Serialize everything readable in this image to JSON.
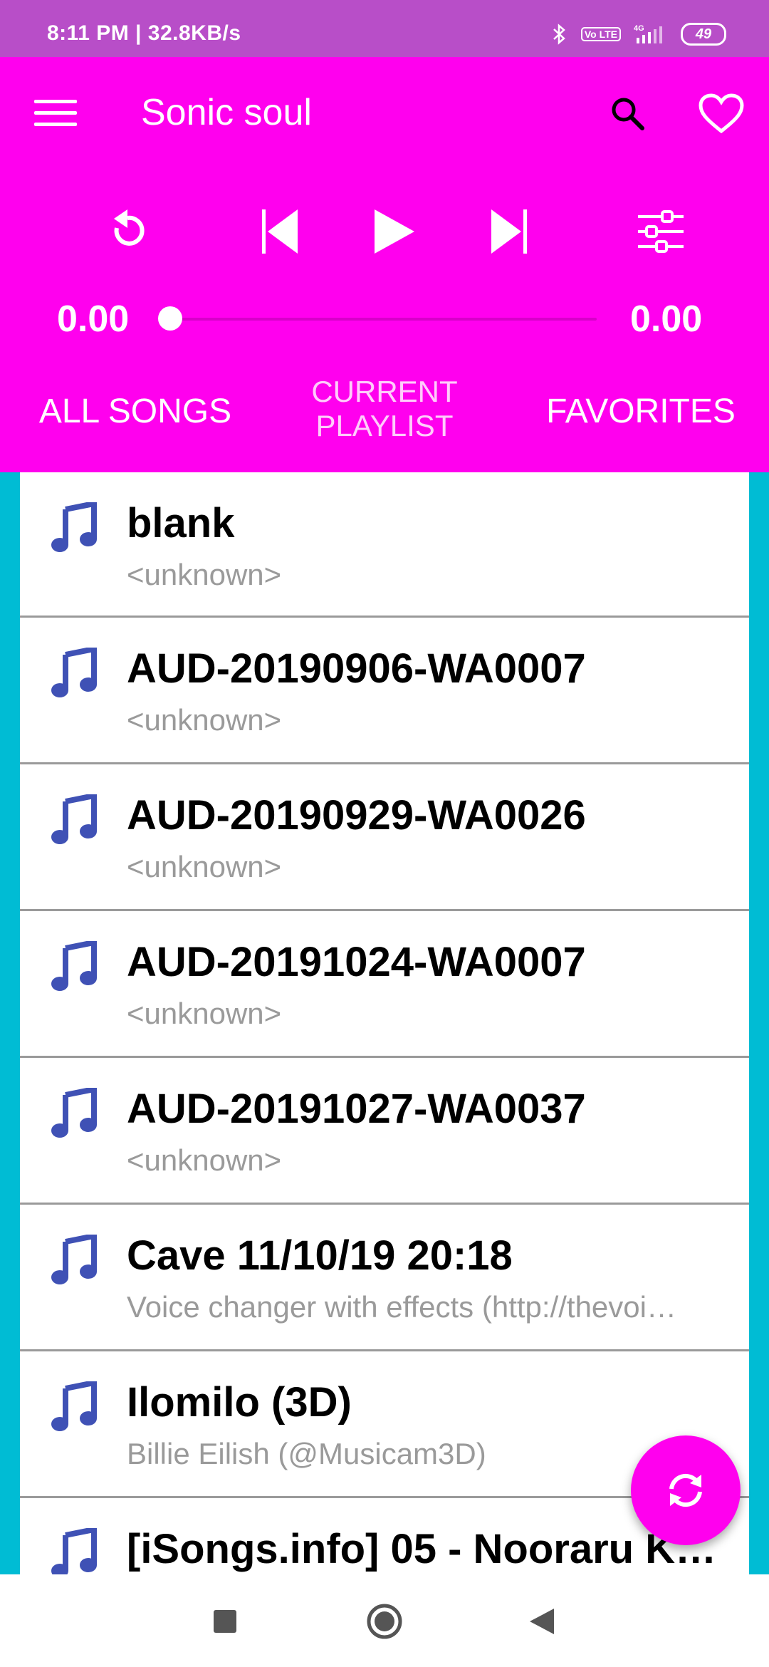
{
  "status_bar": {
    "time": "8:11 PM | 32.8KB/s",
    "battery": "49",
    "volte": "Vo LTE",
    "network": "4G"
  },
  "app": {
    "title": "Sonic soul",
    "accent_color": "#ff00ee",
    "list_background": "#00bcd4",
    "note_icon_color": "#3f51b5"
  },
  "player": {
    "elapsed": "0.00",
    "duration": "0.00",
    "progress": 0
  },
  "tabs": [
    {
      "label": "ALL SONGS"
    },
    {
      "label": "CURRENT PLAYLIST"
    },
    {
      "label": "FAVORITES"
    }
  ],
  "songs": [
    {
      "title": "blank",
      "artist": "<unknown>"
    },
    {
      "title": "AUD-20190906-WA0007",
      "artist": "<unknown>"
    },
    {
      "title": "AUD-20190929-WA0026",
      "artist": "<unknown>"
    },
    {
      "title": "AUD-20191024-WA0007",
      "artist": "<unknown>"
    },
    {
      "title": "AUD-20191027-WA0037",
      "artist": "<unknown>"
    },
    {
      "title": "Cave 11/10/19 20:18",
      "artist": "Voice changer with effects (http://thevoi…"
    },
    {
      "title": "Ilomilo (3D)",
      "artist": "Billie Eilish (@Musicam3D)"
    },
    {
      "title": "[iSongs.info] 05 - Nooraru K…",
      "artist": ""
    }
  ]
}
